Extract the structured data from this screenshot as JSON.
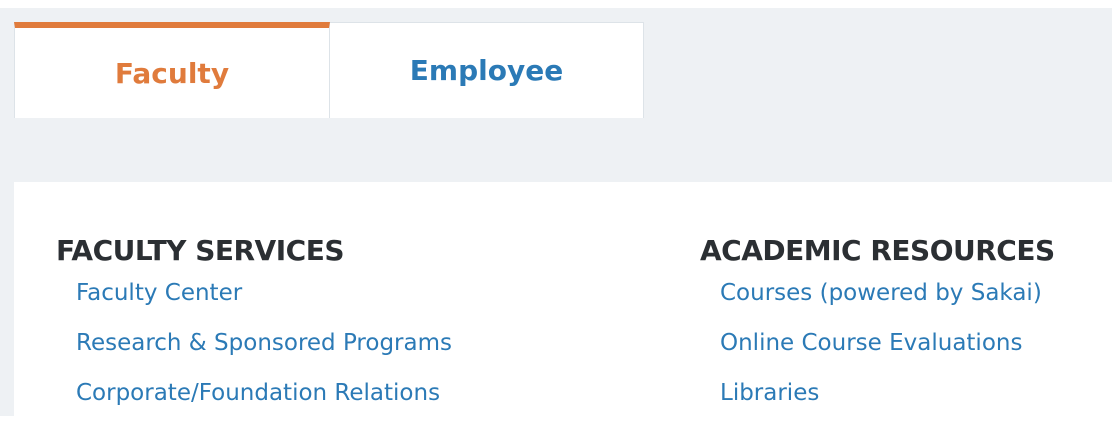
{
  "tabs": [
    {
      "label": "Faculty",
      "active": true
    },
    {
      "label": "Employee",
      "active": false
    }
  ],
  "faculty_services": {
    "heading": "FACULTY SERVICES",
    "links": [
      "Faculty Center",
      "Research & Sponsored Programs",
      "Corporate/Foundation Relations"
    ]
  },
  "academic_resources": {
    "heading": "ACADEMIC RESOURCES",
    "links": [
      "Courses (powered by Sakai)",
      "Online Course Evaluations",
      "Libraries"
    ]
  },
  "colors": {
    "accent": "#e07b3c",
    "link": "#2b7ab6",
    "heading": "#2b2f33",
    "background": "#eef1f4"
  }
}
